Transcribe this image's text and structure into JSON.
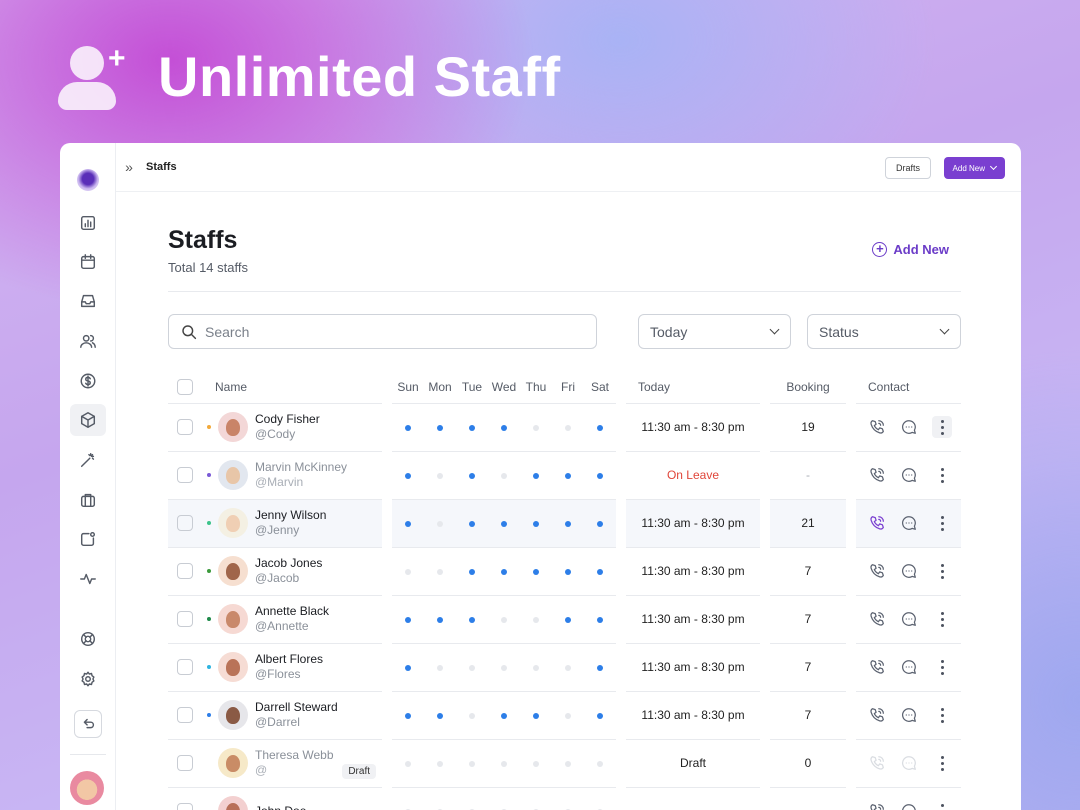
{
  "hero": {
    "title": "Unlimited Staff",
    "icon": "user-plus-icon"
  },
  "topbar": {
    "breadcrumb": "Staffs",
    "drafts_label": "Drafts",
    "add_new_label": "Add New",
    "accent": "#7a3fd0"
  },
  "page": {
    "title": "Staffs",
    "subtitle": "Total 14 staffs",
    "add_new_label": "Add New"
  },
  "filters": {
    "search_placeholder": "Search",
    "date_selected": "Today",
    "status_selected": "Status"
  },
  "table": {
    "headers": {
      "name": "Name",
      "days": [
        "Sun",
        "Mon",
        "Tue",
        "Wed",
        "Thu",
        "Fri",
        "Sat"
      ],
      "today": "Today",
      "booking": "Booking",
      "contact": "Contact"
    },
    "rows": [
      {
        "name": "Cody Fisher",
        "handle": "@Cody",
        "status_color": "#f2a93b",
        "days": [
          1,
          1,
          1,
          1,
          0,
          0,
          1
        ],
        "today": "11:30 am - 8:30 pm",
        "booking": "19",
        "avatar_bg": "#f3d7d7",
        "face": "#c98468"
      },
      {
        "name": "Marvin McKinney",
        "handle": "@Marvin",
        "status_color": "#7a5ad6",
        "days": [
          1,
          0,
          1,
          0,
          1,
          1,
          1
        ],
        "today": "On Leave",
        "booking": "-",
        "avatar_bg": "#e2e7ef",
        "face": "#e8c6a8",
        "faded": true
      },
      {
        "name": "Jenny Wilson",
        "handle": "@Jenny",
        "status_color": "#3bc38a",
        "days": [
          1,
          0,
          1,
          1,
          1,
          1,
          1
        ],
        "today": "11:30 am - 8:30 pm",
        "booking": "21",
        "avatar_bg": "#f4f0e3",
        "face": "#f0cfb4"
      },
      {
        "name": "Jacob Jones",
        "handle": "@Jacob",
        "status_color": "#3c9a3c",
        "days": [
          0,
          0,
          1,
          1,
          1,
          1,
          1
        ],
        "today": "11:30 am - 8:30 pm",
        "booking": "7",
        "avatar_bg": "#f6dfd0",
        "face": "#a0654a"
      },
      {
        "name": "Annette Black",
        "handle": "@Annette",
        "status_color": "#1f8a4a",
        "days": [
          1,
          1,
          1,
          0,
          0,
          1,
          1
        ],
        "today": "11:30 am - 8:30 pm",
        "booking": "7",
        "avatar_bg": "#f6d9d3",
        "face": "#c9896b"
      },
      {
        "name": "Albert Flores",
        "handle": "@Flores",
        "status_color": "#2fb4e0",
        "days": [
          1,
          0,
          0,
          0,
          0,
          0,
          1
        ],
        "today": "11:30 am - 8:30 pm",
        "booking": "7",
        "avatar_bg": "#f6dcd4",
        "face": "#b97358"
      },
      {
        "name": "Darrell Steward",
        "handle": "@Darrel",
        "status_color": "#2d7ee8",
        "days": [
          1,
          1,
          0,
          1,
          1,
          0,
          1
        ],
        "today": "11:30 am - 8:30 pm",
        "booking": "7",
        "avatar_bg": "#e6e6ea",
        "face": "#8a5a45"
      },
      {
        "name": "Theresa Webb",
        "handle": "@",
        "status_color": "",
        "tag": "Draft",
        "days": [
          0,
          0,
          0,
          0,
          0,
          0,
          0
        ],
        "today": "Draft",
        "booking": "0",
        "avatar_bg": "#f6e9c8",
        "face": "#c98c66",
        "faded": true,
        "dim": true
      },
      {
        "name": "John Doe",
        "handle": "",
        "status_color": "",
        "days": [
          0,
          0,
          0,
          0,
          0,
          0,
          0
        ],
        "today": "",
        "booking": "",
        "avatar_bg": "#f3d0d0",
        "face": "#b86f58"
      }
    ]
  }
}
